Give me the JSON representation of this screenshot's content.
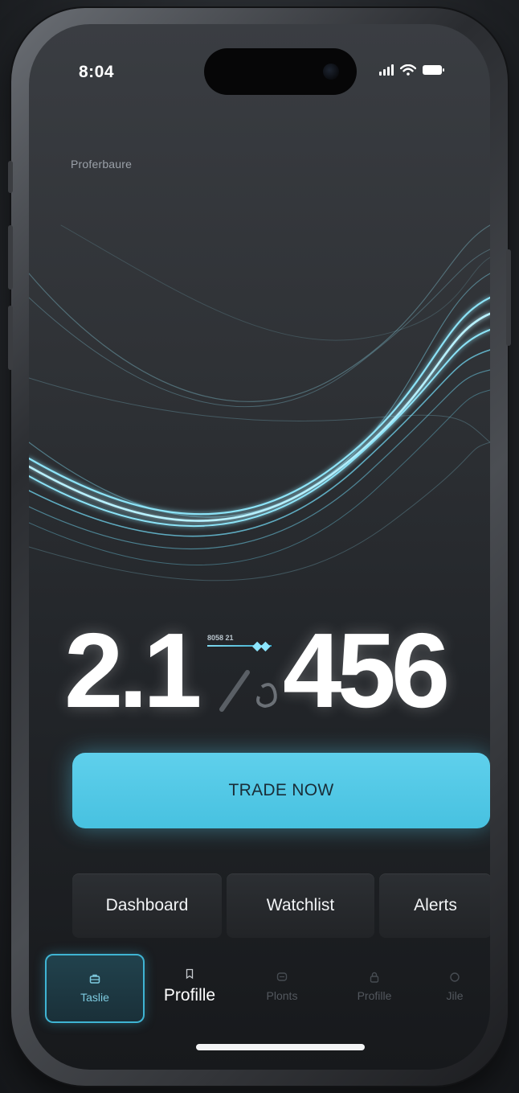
{
  "status_bar": {
    "time": "8:04"
  },
  "header": {
    "label": "Proferbaure"
  },
  "hero": {
    "value_left": "2.1",
    "value_right": "456",
    "mid_tag": "8058 21"
  },
  "actions": {
    "trade_label": "TRADE NOW"
  },
  "quick_links": [
    {
      "label": "Dashboard"
    },
    {
      "label": "Watchlist"
    },
    {
      "label": "Alerts"
    }
  ],
  "tabbar": {
    "tabs": [
      {
        "label": "Taslie",
        "icon": "briefcase-icon"
      },
      {
        "label": "Profille",
        "icon": "bookmark-icon"
      },
      {
        "label": "Plonts",
        "icon": "chat-icon"
      },
      {
        "label": "Profille",
        "icon": "lock-icon"
      },
      {
        "label": "Jile",
        "icon": "circle-icon"
      }
    ]
  },
  "colors": {
    "accent": "#4fc6e4",
    "background": "#23262a"
  }
}
